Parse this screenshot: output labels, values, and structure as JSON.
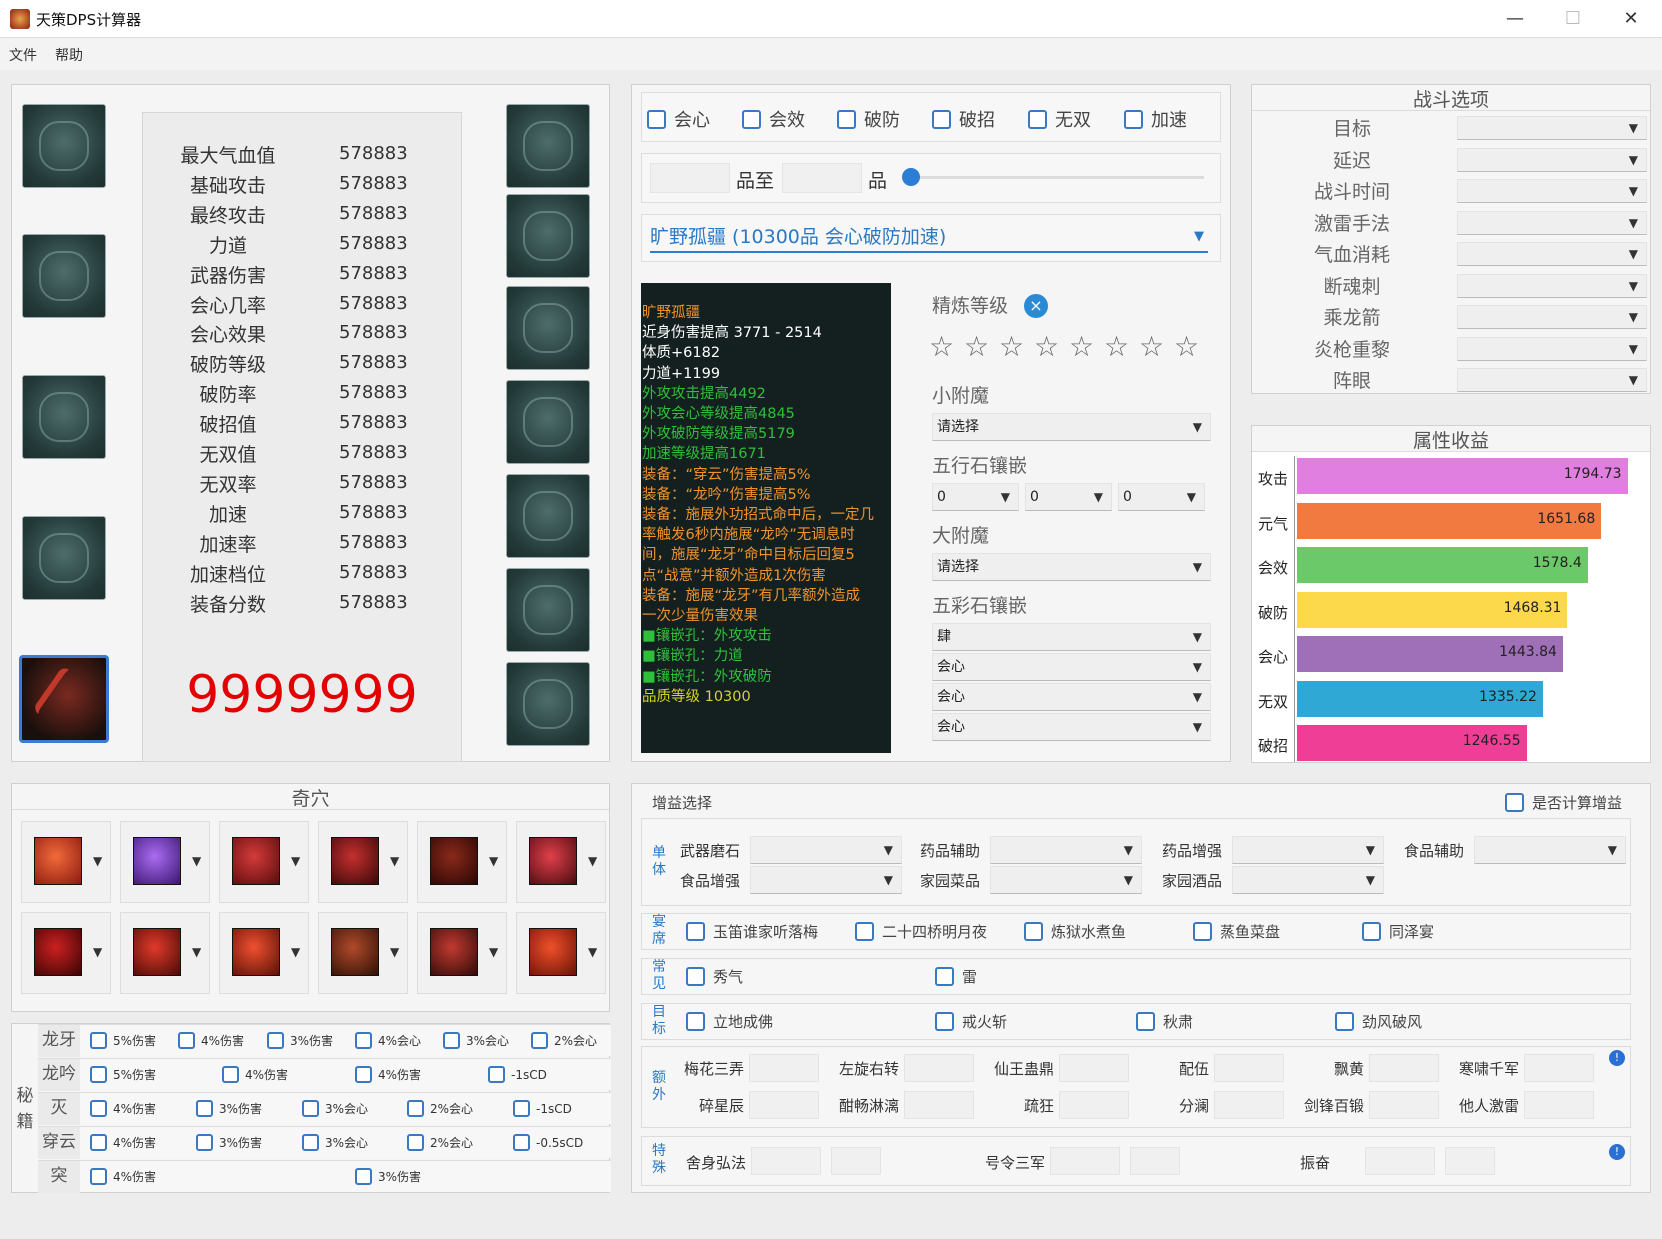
{
  "window": {
    "title": "天策DPS计算器",
    "minimize": "—",
    "maximize": "☐",
    "close": "✕"
  },
  "menu": [
    "文件",
    "帮助"
  ],
  "stats": [
    {
      "label": "最大气血值",
      "value": "578883"
    },
    {
      "label": "基础攻击",
      "value": "578883"
    },
    {
      "label": "最终攻击",
      "value": "578883"
    },
    {
      "label": "力道",
      "value": "578883"
    },
    {
      "label": "武器伤害",
      "value": "578883"
    },
    {
      "label": "会心几率",
      "value": "578883"
    },
    {
      "label": "会心效果",
      "value": "578883"
    },
    {
      "label": "破防等级",
      "value": "578883"
    },
    {
      "label": "破防率",
      "value": "578883"
    },
    {
      "label": "破招值",
      "value": "578883"
    },
    {
      "label": "无双值",
      "value": "578883"
    },
    {
      "label": "无双率",
      "value": "578883"
    },
    {
      "label": "加速",
      "value": "578883"
    },
    {
      "label": "加速率",
      "value": "578883"
    },
    {
      "label": "加速档位",
      "value": "578883"
    },
    {
      "label": "装备分数",
      "value": "578883"
    }
  ],
  "score": "9999999",
  "filters": [
    "会心",
    "会效",
    "破防",
    "破招",
    "无双",
    "加速"
  ],
  "quality": {
    "label1": "品至",
    "label2": "品",
    "slider": 0.0
  },
  "equip_select": "旷野孤疆 (10300品  会心破防加速)",
  "tooltip": [
    {
      "t": "旷野孤疆",
      "c": "#f0932b"
    },
    {
      "t": "近身伤害提高 3771 - 2514",
      "c": "#ffffff"
    },
    {
      "t": "体质+6182",
      "c": "#ffffff"
    },
    {
      "t": "力道+1199",
      "c": "#ffffff"
    },
    {
      "t": "外攻攻击提高4492",
      "c": "#2fbf3a"
    },
    {
      "t": "外攻会心等级提高4845",
      "c": "#2fbf3a"
    },
    {
      "t": "外攻破防等级提高5179",
      "c": "#2fbf3a"
    },
    {
      "t": "加速等级提高1671",
      "c": "#2fbf3a"
    },
    {
      "t": "装备：“穿云”伤害提高5%",
      "c": "#f0932b"
    },
    {
      "t": "装备：“龙吟”伤害提高5%",
      "c": "#f0932b"
    },
    {
      "t": "装备：施展外功招式命中后，一定几",
      "c": "#f0932b"
    },
    {
      "t": "率触发6秒内施展“龙吟”无调息时",
      "c": "#f0932b"
    },
    {
      "t": "间，施展“龙牙”命中目标后回复5",
      "c": "#f0932b"
    },
    {
      "t": "点“战意”并额外造成1次伤害",
      "c": "#f0932b"
    },
    {
      "t": "装备：施展“龙牙”有几率额外造成",
      "c": "#f0932b"
    },
    {
      "t": "一次少量伤害效果",
      "c": "#f0932b"
    },
    {
      "t": "■镶嵌孔：外攻攻击",
      "c": "#2fbf3a"
    },
    {
      "t": "■镶嵌孔：力道",
      "c": "#2fbf3a"
    },
    {
      "t": "■镶嵌孔：外攻破防",
      "c": "#2fbf3a"
    },
    {
      "t": " ",
      "c": "#ffffff"
    },
    {
      "t": "品质等级 10300",
      "c": "#d4d422"
    }
  ],
  "refine": {
    "label": "精炼等级",
    "clear": "×",
    "stars": 8
  },
  "enchant": {
    "small_label": "小附魔",
    "small_value": "请选择",
    "wuxing_label": "五行石镶嵌",
    "wuxing_values": [
      "0",
      "0",
      "0"
    ],
    "big_label": "大附魔",
    "big_value": "请选择",
    "wucai_label": "五彩石镶嵌",
    "wucai_values": [
      "肆",
      "会心",
      "会心",
      "会心"
    ]
  },
  "battle": {
    "title": "战斗选项",
    "options": [
      "目标",
      "延迟",
      "战斗时间",
      "激雷手法",
      "气血消耗",
      "断魂刺",
      "乘龙箭",
      "炎枪重黎",
      "阵眼"
    ]
  },
  "attr_gain": {
    "title": "属性收益",
    "chart_data": {
      "type": "bar",
      "categories": [
        "攻击",
        "元气",
        "会效",
        "破防",
        "会心",
        "无双",
        "破招"
      ],
      "values": [
        1794.73,
        1651.68,
        1578.4,
        1468.31,
        1443.84,
        1335.22,
        1246.55
      ],
      "labels": [
        "1794.73",
        "1651.68",
        "1578.4",
        "1468.31",
        "1443.84",
        "1335.22",
        "1246.55"
      ],
      "colors": [
        "#e07fe0",
        "#f07a40",
        "#6cc96a",
        "#fcd94a",
        "#9f70b8",
        "#2fa8d6",
        "#ee3e95"
      ],
      "xlim": [
        0,
        1900
      ]
    }
  },
  "qixue": {
    "title": "奇穴"
  },
  "mijí": {
    "side_label": "秘籍",
    "rows": [
      {
        "name": "龙牙",
        "opts": [
          "5%伤害",
          "4%伤害",
          "3%伤害",
          "4%会心",
          "3%会心",
          "2%会心"
        ]
      },
      {
        "name": "龙吟",
        "opts": [
          "5%伤害",
          "4%伤害",
          "4%伤害",
          "-1sCD"
        ]
      },
      {
        "name": "灭",
        "opts": [
          "4%伤害",
          "3%伤害",
          "3%会心",
          "2%会心",
          "-1sCD"
        ]
      },
      {
        "name": "穿云",
        "opts": [
          "4%伤害",
          "3%伤害",
          "3%会心",
          "2%会心",
          "-0.5sCD"
        ]
      },
      {
        "name": "突",
        "opts": [
          "4%伤害",
          "3%伤害"
        ]
      }
    ]
  },
  "buff": {
    "title": "增益选择",
    "calc_label": "是否计算增益",
    "single_label": "单体",
    "single": [
      "武器磨石",
      "药品辅助",
      "药品增强",
      "食品辅助",
      "食品增强",
      "家园菜品",
      "家园酒品"
    ],
    "feast_label": "宴席",
    "feast": [
      "玉笛谁家听落梅",
      "二十四桥明月夜",
      "炼狱水煮鱼",
      "蒸鱼菜盘",
      "同泽宴"
    ],
    "common_label": "常见",
    "common": [
      "秀气",
      "雷"
    ],
    "target_label": "目标",
    "target": [
      "立地成佛",
      "戒火斩",
      "秋肃",
      "劲风破风"
    ],
    "extra_label": "额外",
    "extra": [
      "梅花三弄",
      "左旋右转",
      "仙王蛊鼎",
      "配伍",
      "飘黄",
      "寒啸千军",
      "碎星辰",
      "酣畅淋漓",
      "疏狂",
      "分澜",
      "剑锋百锻",
      "他人激雷"
    ],
    "special_label": "特殊",
    "special": [
      "舍身弘法",
      "号令三军",
      "振奋"
    ],
    "info": "!"
  }
}
